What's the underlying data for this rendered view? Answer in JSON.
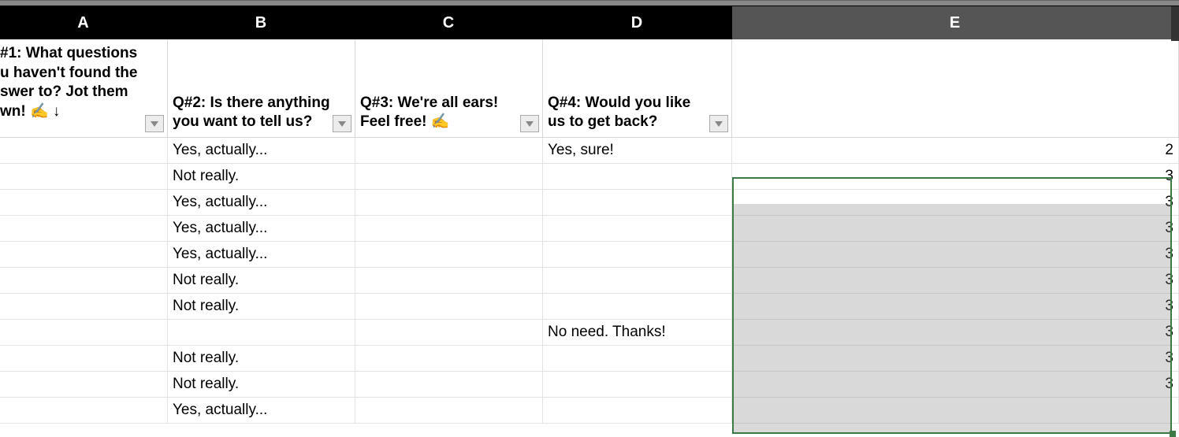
{
  "columns": [
    "A",
    "B",
    "C",
    "D",
    "E"
  ],
  "selectedColumn": "E",
  "headers": {
    "A": "#1: What questions u haven't found the swer to? Jot them wn! ✍️ ↓",
    "B": "Q#2: Is there anything you want to tell us?",
    "C": "Q#3: We're all ears! Feel free! ✍️",
    "D": "Q#4: Would you like us to get back?",
    "E": ""
  },
  "rows": [
    {
      "A": "",
      "B": "Yes, actually...",
      "C": "",
      "D": "Yes, sure!",
      "E": "2"
    },
    {
      "A": "",
      "B": "Not really.",
      "C": "",
      "D": "",
      "E": "3"
    },
    {
      "A": "",
      "B": "Yes, actually...",
      "C": "",
      "D": "",
      "E": "3"
    },
    {
      "A": "",
      "B": "Yes, actually...",
      "C": "",
      "D": "",
      "E": "3"
    },
    {
      "A": "",
      "B": "Yes, actually...",
      "C": "",
      "D": "",
      "E": "3"
    },
    {
      "A": "",
      "B": "Not really.",
      "C": "",
      "D": "",
      "E": "3"
    },
    {
      "A": "",
      "B": "Not really.",
      "C": "",
      "D": "",
      "E": "3"
    },
    {
      "A": "",
      "B": "",
      "C": "",
      "D": "No need. Thanks!",
      "E": "3"
    },
    {
      "A": "",
      "B": "Not really.",
      "C": "",
      "D": "",
      "E": "3"
    },
    {
      "A": "",
      "B": "Not really.",
      "C": "",
      "D": "",
      "E": "3"
    },
    {
      "A": "",
      "B": "Yes, actually...",
      "C": "",
      "D": "",
      "E": ""
    }
  ]
}
